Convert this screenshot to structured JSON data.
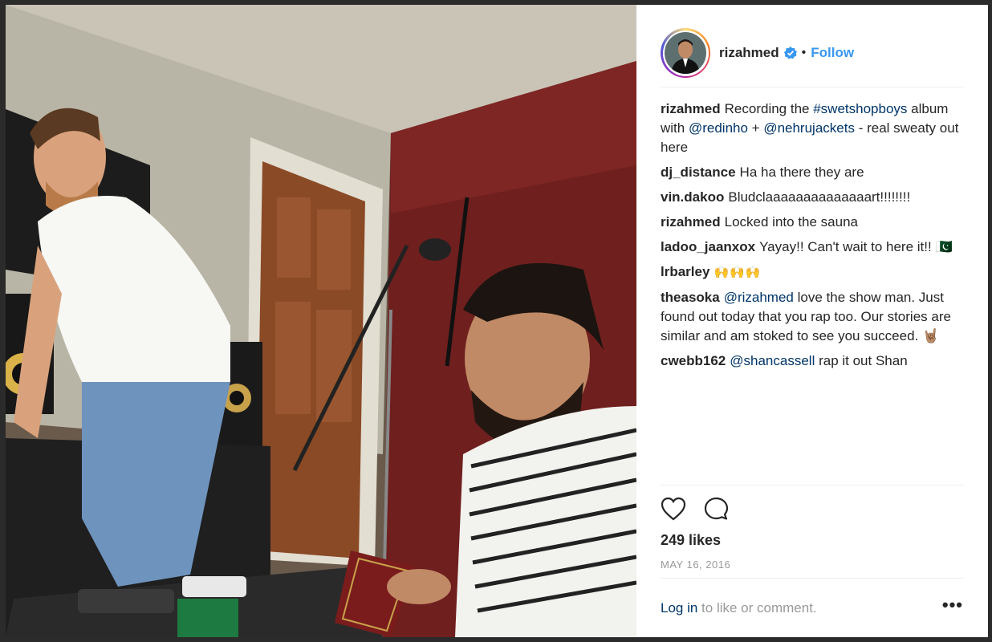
{
  "post": {
    "username": "rizahmed",
    "follow_label": "Follow",
    "separator": "•",
    "caption": {
      "user": "rizahmed",
      "parts": [
        "Recording the ",
        "#swetshopboys",
        " album with ",
        "@redinho",
        " + ",
        "@nehrujackets",
        " - real sweaty out here"
      ]
    },
    "comments": [
      {
        "user": "dj_distance",
        "text": "Ha ha there they are"
      },
      {
        "user": "vin.dakoo",
        "text": "Bludclaaaaaaaaaaaaaart!!!!!!!!"
      },
      {
        "user": "rizahmed",
        "text": "Locked into the sauna"
      },
      {
        "user": "ladoo_jaanxox",
        "text": "Yayay!! Can't wait to here it!!",
        "emoji": "🇵🇰"
      },
      {
        "user": "lrbarley",
        "text": "",
        "emoji": "🙌🙌🙌"
      },
      {
        "user": "theasoka",
        "mention": "@rizahmed",
        "text": " love the show man. Just found out today that you rap too. Our stories are similar and am stoked to see you succeed.",
        "emoji": "🤘🏽"
      },
      {
        "user": "cwebb162",
        "mention": "@shancassell",
        "text": " rap it out Shan"
      }
    ],
    "likes": "249 likes",
    "date": "MAY 16, 2016",
    "login_link": "Log in",
    "login_rest": " to like or comment.",
    "more_label": "•••"
  },
  "icons": {
    "like": "heart-icon",
    "comment": "comment-icon",
    "verified": "verified-badge-icon",
    "more": "more-options-icon"
  },
  "colors": {
    "follow": "#3897f0",
    "link": "#003569",
    "muted": "#999999",
    "text": "#262626"
  }
}
